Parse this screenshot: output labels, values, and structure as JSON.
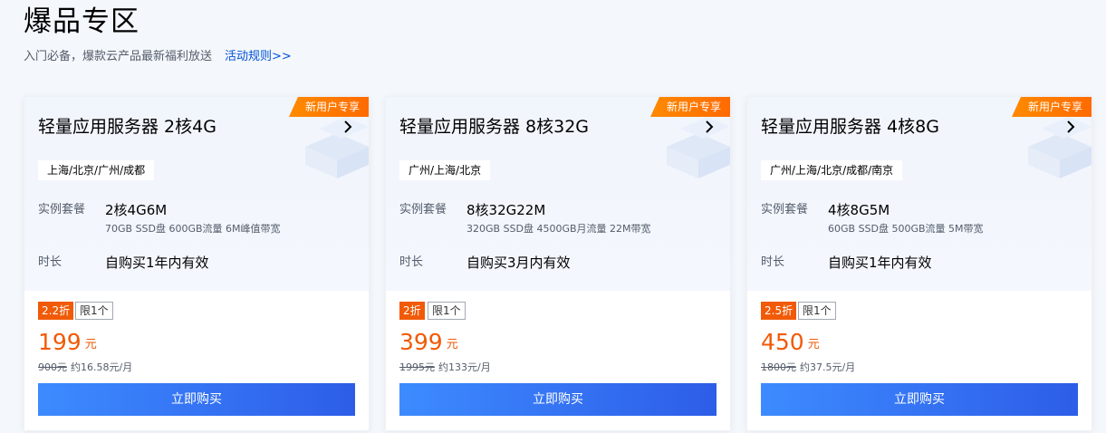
{
  "header": {
    "title": "爆品专区",
    "subtitle": "入门必备，爆款云产品最新福利放送",
    "rules_link": "活动规则>>"
  },
  "colors": {
    "accent_orange": "#f15a07",
    "badge_orange": "#ff6a00",
    "link_blue": "#0052d9",
    "button_blue_start": "#3d8bff",
    "button_blue_end": "#2d5de8"
  },
  "cards": [
    {
      "badge": "新用户专享",
      "title": "轻量应用服务器 2核4G",
      "regions": "上海/北京/广州/成都",
      "spec_label": "实例套餐",
      "spec_main": "2核4G6M",
      "spec_detail": "70GB SSD盘 600GB流量 6M峰值带宽",
      "duration_label": "时长",
      "duration_value": "自购买1年内有效",
      "discount": "2.2折",
      "limit": "限1个",
      "price": "199",
      "price_unit": "元",
      "original_price": "900元",
      "monthly": "约16.58元/月",
      "buy_label": "立即购买"
    },
    {
      "badge": "新用户专享",
      "title": "轻量应用服务器 8核32G",
      "regions": "广州/上海/北京",
      "spec_label": "实例套餐",
      "spec_main": "8核32G22M",
      "spec_detail": "320GB SSD盘 4500GB月流量 22M带宽",
      "duration_label": "时长",
      "duration_value": "自购买3月内有效",
      "discount": "2折",
      "limit": "限1个",
      "price": "399",
      "price_unit": "元",
      "original_price": "1995元",
      "monthly": "约133元/月",
      "buy_label": "立即购买"
    },
    {
      "badge": "新用户专享",
      "title": "轻量应用服务器 4核8G",
      "regions": "广州/上海/北京/成都/南京",
      "spec_label": "实例套餐",
      "spec_main": "4核8G5M",
      "spec_detail": "60GB SSD盘 500GB流量 5M带宽",
      "duration_label": "时长",
      "duration_value": "自购买1年内有效",
      "discount": "2.5折",
      "limit": "限1个",
      "price": "450",
      "price_unit": "元",
      "original_price": "1800元",
      "monthly": "约37.5元/月",
      "buy_label": "立即购买"
    }
  ]
}
